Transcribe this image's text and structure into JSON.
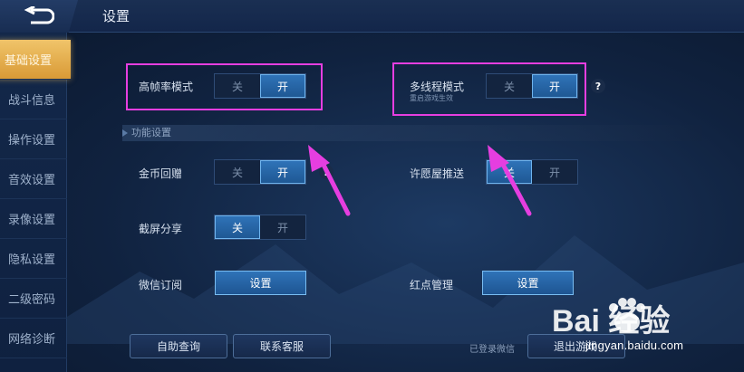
{
  "header": {
    "title": "设置"
  },
  "sidebar": {
    "items": [
      {
        "label": "基础设置",
        "active": true
      },
      {
        "label": "战斗信息",
        "active": false
      },
      {
        "label": "操作设置",
        "active": false
      },
      {
        "label": "音效设置",
        "active": false
      },
      {
        "label": "录像设置",
        "active": false
      },
      {
        "label": "隐私设置",
        "active": false
      },
      {
        "label": "二级密码",
        "active": false
      },
      {
        "label": "网络诊断",
        "active": false
      }
    ]
  },
  "settings": {
    "high_fps": {
      "label": "高帧率模式",
      "off": "关",
      "on": "开",
      "state": "on"
    },
    "multithread": {
      "label": "多线程模式",
      "sublabel": "重启游戏生效",
      "off": "关",
      "on": "开",
      "state": "on",
      "help": "?"
    },
    "section_title": "功能设置",
    "coin_reward": {
      "label": "金币回赠",
      "off": "关",
      "on": "开",
      "state": "on",
      "help": "?"
    },
    "wish_push": {
      "label": "许愿屋推送",
      "off": "关",
      "on": "开",
      "state": "off"
    },
    "screenshot_share": {
      "label": "截屏分享",
      "off": "关",
      "on": "开",
      "state": "off"
    },
    "wechat_sub": {
      "label": "微信订阅",
      "button": "设置"
    },
    "red_dot": {
      "label": "红点管理",
      "button": "设置"
    }
  },
  "footer": {
    "self_help": "自助查询",
    "contact": "联系客服",
    "logged_in": "已登录微信",
    "logout": "退出游戏"
  },
  "watermark": {
    "brand": "Bai  经验",
    "url": "jingyan.baidu.com"
  },
  "colors": {
    "highlight": "#e63ee0",
    "toggle_on": "#2f73b8",
    "sidebar_active": "#e2a94a"
  }
}
